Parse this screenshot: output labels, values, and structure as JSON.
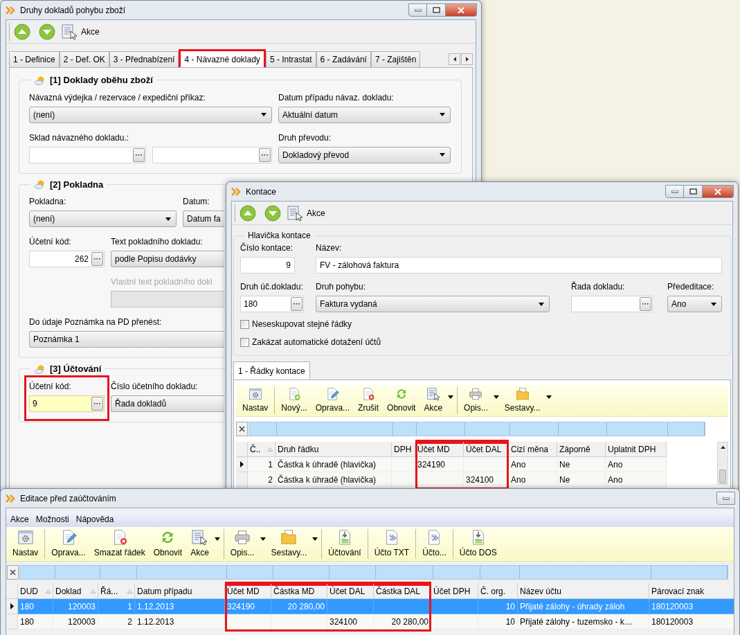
{
  "main_window": {
    "title": "Druhy dokladů pohybu zboží",
    "toolbar": {
      "label": "Akce"
    },
    "tabs": [
      {
        "label": "1 - Definice",
        "selected": false,
        "highlighted": false
      },
      {
        "label": "2 - Def. OK",
        "selected": false,
        "highlighted": false
      },
      {
        "label": "3 - Přednabízení",
        "selected": false,
        "highlighted": false
      },
      {
        "label": "4 - Návazné doklady",
        "selected": true,
        "highlighted": true
      },
      {
        "label": "5 - Intrastat",
        "selected": false,
        "highlighted": false
      },
      {
        "label": "6 - Zadávání",
        "selected": false,
        "highlighted": false
      },
      {
        "label": "7 - Zajištěn",
        "selected": false,
        "highlighted": false
      }
    ],
    "sections": [
      {
        "title": "[1] Doklady oběhu zboží",
        "rows": [
          [
            {
              "kind": "select",
              "label": "Návazná výdejka / rezervace / expediční příkaz:",
              "value": "(není)",
              "disabled": false
            },
            {
              "kind": "select",
              "label": "Datum případu návaz. dokladu:",
              "value": "Aktuální datum",
              "disabled": false
            }
          ],
          [
            {
              "kind": "lookup_pair",
              "label": "Sklad návazného dokladu.:",
              "disabled": false
            },
            {
              "kind": "select",
              "label": "Druh převodu:",
              "value": "Dokladový převod",
              "disabled": false
            }
          ]
        ]
      },
      {
        "title": "[2] Pokladna",
        "rows": [
          [
            {
              "kind": "select",
              "label": "Pokladna:",
              "value": "(není)",
              "disabled": false
            },
            {
              "kind": "select",
              "label": "Datum:",
              "value": "Datum fa",
              "disabled": false
            }
          ],
          [
            {
              "kind": "lookup",
              "label": "Účetní kód:",
              "value": "262",
              "disabled": false,
              "focused": false,
              "highlighted": false
            },
            {
              "kind": "select",
              "label": "Text pokladního dokladu:",
              "value": "podle Popisu dodávky",
              "disabled": false
            }
          ],
          [
            {
              "kind": "input",
              "label": "Vlastní text pokladního dokl",
              "disabled": true
            }
          ],
          [
            {
              "kind": "select",
              "label": "Do údaje Poznámka na PD přenést:",
              "value": "Poznámka 1",
              "disabled": false
            }
          ]
        ]
      },
      {
        "title": "[3] Účtování",
        "rows": [
          [
            {
              "kind": "lookup",
              "label": "Účetní kód:",
              "value": "9",
              "disabled": false,
              "focused": true,
              "highlighted": true
            },
            {
              "kind": "select",
              "label": "Číslo účetního dokladu:",
              "value": "Řada dokladů",
              "disabled": false
            }
          ]
        ]
      }
    ]
  },
  "kontace_window": {
    "title": "Kontace",
    "toolbar": {
      "label": "Akce"
    },
    "header": {
      "title": "Hlavička kontace",
      "rows": [
        [
          {
            "kind": "input",
            "label": "Číslo kontace:",
            "value": "9"
          },
          {
            "kind": "input",
            "label": "Název:",
            "value": "FV - zálohová faktura"
          }
        ],
        [
          {
            "kind": "lookup",
            "label": "Druh úč.dokladu:",
            "value": "180"
          },
          {
            "kind": "select",
            "label": "Druh pohybu:",
            "value": "Faktura vydaná"
          },
          {
            "kind": "lookup",
            "label": "Řada dokladu:"
          },
          {
            "kind": "select",
            "label": "Přededitace:",
            "value": "Ano"
          }
        ]
      ],
      "checkboxes": [
        {
          "label": "Neseskupovat stejné řádky",
          "checked": false
        },
        {
          "label": "Zakázat automatické dotažení účtů",
          "checked": false
        }
      ]
    },
    "tabs": [
      {
        "label": "1 - Řádky kontace",
        "selected": true
      }
    ],
    "toolbar_groups": [
      [
        {
          "kind": "settings",
          "label": "Nastav",
          "dropdown": false
        }
      ],
      [
        {
          "kind": "new",
          "label": "Nový...",
          "dropdown": false
        },
        {
          "kind": "edit",
          "label": "Oprava...",
          "dropdown": false
        },
        {
          "kind": "delete",
          "label": "Zrušit",
          "dropdown": false
        },
        {
          "kind": "refresh",
          "label": "Obnovit",
          "dropdown": false
        },
        {
          "kind": "actions",
          "label": "Akce",
          "dropdown": true
        }
      ],
      [
        {
          "kind": "print",
          "label": "Opis...",
          "dropdown": true
        },
        {
          "kind": "reports",
          "label": "Sestavy...",
          "dropdown": true
        }
      ]
    ],
    "table": {
      "columns": [
        {
          "label": "Č..",
          "kind": "number",
          "sorted": true,
          "highlighted": false
        },
        {
          "label": "Druh řádku",
          "kind": "text",
          "sorted": false,
          "highlighted": false
        },
        {
          "label": "DPH",
          "kind": "text",
          "sorted": false,
          "highlighted": false
        },
        {
          "label": "Účet MD",
          "kind": "text",
          "sorted": false,
          "highlighted": true
        },
        {
          "label": "Účet DAL",
          "kind": "text",
          "sorted": false,
          "highlighted": true
        },
        {
          "label": "Cizí měna",
          "kind": "text",
          "sorted": false,
          "highlighted": false
        },
        {
          "label": "Záporně",
          "kind": "text",
          "sorted": false,
          "highlighted": false
        },
        {
          "label": "Uplatnit DPH",
          "kind": "text",
          "sorted": false,
          "highlighted": false
        }
      ],
      "rows": [
        {
          "current": true,
          "selected": false,
          "cells": [
            "1",
            "Částka k úhradě (hlavička)",
            null,
            "324190",
            null,
            "Ano",
            "Ne",
            "Ano"
          ]
        },
        {
          "current": false,
          "selected": false,
          "cells": [
            "2",
            "Částka k úhradě (hlavička)",
            null,
            null,
            "324100",
            "Ano",
            "Ne",
            "Ano"
          ]
        }
      ]
    }
  },
  "editace_window": {
    "title": "Editace před zaúčtováním",
    "menu": [
      "Akce",
      "Možnosti",
      "Nápověda"
    ],
    "toolbar_groups": [
      [
        {
          "kind": "settings",
          "label": "Nastav",
          "dropdown": false
        }
      ],
      [
        {
          "kind": "edit",
          "label": "Oprava...",
          "dropdown": false
        },
        {
          "kind": "delete",
          "label": "Smazat řádek",
          "dropdown": false
        },
        {
          "kind": "refresh",
          "label": "Obnovit",
          "dropdown": false
        },
        {
          "kind": "actions",
          "label": "Akce",
          "dropdown": true
        }
      ],
      [
        {
          "kind": "print",
          "label": "Opis...",
          "dropdown": true
        },
        {
          "kind": "reports",
          "label": "Sestavy...",
          "dropdown": true
        }
      ],
      [
        {
          "kind": "post",
          "label": "Účtování",
          "dropdown": false
        }
      ],
      [
        {
          "kind": "post_txt",
          "label": "Účto TXT",
          "dropdown": false
        }
      ],
      [
        {
          "kind": "post_other",
          "label": "Účto...",
          "dropdown": false
        }
      ],
      [
        {
          "kind": "post",
          "label": "Účto DOS",
          "dropdown": false
        }
      ]
    ],
    "table": {
      "columns": [
        {
          "label": "DUD",
          "kind": "text",
          "sorted": true,
          "highlighted": false
        },
        {
          "label": "Doklad",
          "kind": "number",
          "sorted": true,
          "highlighted": false
        },
        {
          "label": "Řá...",
          "kind": "number",
          "sorted": true,
          "highlighted": false
        },
        {
          "label": "Datum případu",
          "kind": "text",
          "sorted": false,
          "highlighted": false
        },
        {
          "label": "Účet MD",
          "kind": "text",
          "sorted": false,
          "highlighted": true
        },
        {
          "label": "Částka MD",
          "kind": "number",
          "sorted": false,
          "highlighted": true
        },
        {
          "label": "Účet DAL",
          "kind": "text",
          "sorted": false,
          "highlighted": true
        },
        {
          "label": "Částka DAL",
          "kind": "number",
          "sorted": false,
          "highlighted": true
        },
        {
          "label": "Účet DPH",
          "kind": "text",
          "sorted": false,
          "highlighted": false
        },
        {
          "label": "Č. org.",
          "kind": "number",
          "sorted": false,
          "highlighted": false
        },
        {
          "label": "Název účtu",
          "kind": "text",
          "sorted": false,
          "highlighted": false
        },
        {
          "label": "Párovací znak",
          "kind": "text",
          "sorted": false,
          "highlighted": false
        }
      ],
      "rows": [
        {
          "current": true,
          "selected": true,
          "cells": [
            "180",
            "120003",
            "1",
            "1.12.2013",
            "324190",
            "20 280,00",
            null,
            null,
            null,
            "10",
            "Přijaté zálohy - úhrady záloh",
            "180120003"
          ]
        },
        {
          "current": false,
          "selected": false,
          "cells": [
            "180",
            "120003",
            "2",
            "1.12.2013",
            null,
            null,
            "324100",
            "20 280,00",
            null,
            "10",
            "Přijaté zálohy - tuzemsko - k…",
            "180120003"
          ]
        }
      ]
    }
  }
}
